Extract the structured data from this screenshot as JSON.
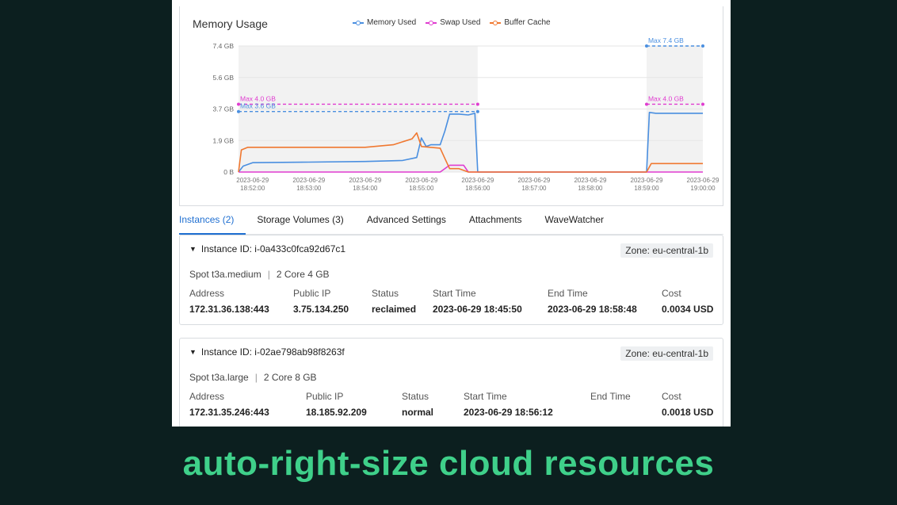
{
  "chart": {
    "title": "Memory Usage",
    "legend": [
      {
        "name": "Memory Used",
        "color": "#4a8fe0"
      },
      {
        "name": "Swap Used",
        "color": "#e03cd0"
      },
      {
        "name": "Buffer Cache",
        "color": "#f07830"
      }
    ],
    "y_ticks": [
      "7.4 GB",
      "5.6 GB",
      "3.7 GB",
      "1.9 GB",
      "0 B"
    ],
    "x_ticks": [
      {
        "date": "2023-06-29",
        "time": "18:52:00"
      },
      {
        "date": "2023-06-29",
        "time": "18:53:00"
      },
      {
        "date": "2023-06-29",
        "time": "18:54:00"
      },
      {
        "date": "2023-06-29",
        "time": "18:55:00"
      },
      {
        "date": "2023-06-29",
        "time": "18:56:00"
      },
      {
        "date": "2023-06-29",
        "time": "18:57:00"
      },
      {
        "date": "2023-06-29",
        "time": "18:58:00"
      },
      {
        "date": "2023-06-29",
        "time": "18:59:00"
      },
      {
        "date": "2023-06-29",
        "time": "19:00:00"
      }
    ],
    "annotations": {
      "first_max_swap": "Max 4.0 GB",
      "first_max_mem": "Max 3.6 GB",
      "second_max_mem": "Max 7.4 GB",
      "second_max_swap": "Max 4.0 GB"
    }
  },
  "chart_data": {
    "type": "line",
    "title": "Memory Usage",
    "x_unit": "time (2023-06-29)",
    "y_unit": "GB",
    "ylim": [
      0,
      7.4
    ],
    "xlim": [
      "18:51:45",
      "19:00:00"
    ],
    "shaded_regions": [
      [
        "18:51:45",
        "18:56:00"
      ],
      [
        "18:59:00",
        "19:00:00"
      ]
    ],
    "series": [
      {
        "name": "Memory Used",
        "color": "#4a8fe0",
        "points": [
          [
            "18:51:45",
            0
          ],
          [
            "18:51:50",
            0.35
          ],
          [
            "18:52:00",
            0.55
          ],
          [
            "18:53:00",
            0.58
          ],
          [
            "18:54:00",
            0.62
          ],
          [
            "18:54:40",
            0.68
          ],
          [
            "18:54:55",
            0.85
          ],
          [
            "18:55:00",
            2.0
          ],
          [
            "18:55:05",
            1.5
          ],
          [
            "18:55:10",
            1.6
          ],
          [
            "18:55:20",
            1.6
          ],
          [
            "18:55:25",
            2.4
          ],
          [
            "18:55:30",
            3.4
          ],
          [
            "18:55:40",
            3.4
          ],
          [
            "18:55:50",
            3.35
          ],
          [
            "18:55:57",
            3.45
          ],
          [
            "18:56:00",
            0
          ],
          [
            "18:59:00",
            0
          ],
          [
            "18:59:03",
            3.5
          ],
          [
            "18:59:10",
            3.45
          ],
          [
            "19:00:00",
            3.45
          ]
        ]
      },
      {
        "name": "Swap Used",
        "color": "#e03cd0",
        "points": [
          [
            "18:51:45",
            0
          ],
          [
            "18:55:20",
            0
          ],
          [
            "18:55:30",
            0.4
          ],
          [
            "18:55:45",
            0.4
          ],
          [
            "18:55:50",
            0
          ],
          [
            "19:00:00",
            0
          ]
        ]
      },
      {
        "name": "Buffer Cache",
        "color": "#f07830",
        "points": [
          [
            "18:51:45",
            0
          ],
          [
            "18:51:48",
            1.3
          ],
          [
            "18:51:55",
            1.45
          ],
          [
            "18:54:00",
            1.45
          ],
          [
            "18:54:30",
            1.6
          ],
          [
            "18:54:50",
            1.95
          ],
          [
            "18:54:55",
            2.3
          ],
          [
            "18:55:00",
            1.5
          ],
          [
            "18:55:20",
            1.4
          ],
          [
            "18:55:25",
            0.8
          ],
          [
            "18:55:30",
            0.2
          ],
          [
            "18:55:40",
            0.2
          ],
          [
            "18:55:50",
            0
          ],
          [
            "18:59:00",
            0
          ],
          [
            "18:59:05",
            0.5
          ],
          [
            "19:00:00",
            0.5
          ]
        ]
      }
    ]
  },
  "tabs": [
    "Instances (2)",
    "Storage Volumes (3)",
    "Advanced Settings",
    "Attachments",
    "WaveWatcher"
  ],
  "headers": {
    "address": "Address",
    "public_ip": "Public IP",
    "status": "Status",
    "start": "Start Time",
    "end": "End Time",
    "cost": "Cost"
  },
  "instances": [
    {
      "id": "Instance ID: i-0a433c0fca92d67c1",
      "zone": "Zone: eu-central-1b",
      "type": "Spot t3a.medium",
      "spec": "2 Core 4 GB",
      "address": "172.31.36.138:443",
      "public_ip": "3.75.134.250",
      "status": "reclaimed",
      "start": "2023-06-29 18:45:50",
      "end": "2023-06-29 18:58:48",
      "cost": "0.0034 USD"
    },
    {
      "id": "Instance ID: i-02ae798ab98f8263f",
      "zone": "Zone: eu-central-1b",
      "type": "Spot t3a.large",
      "spec": "2 Core 8 GB",
      "address": "172.31.35.246:443",
      "public_ip": "18.185.92.209",
      "status": "normal",
      "start": "2023-06-29 18:56:12",
      "end": "",
      "cost": "0.0018 USD"
    }
  ],
  "caption": "auto-right-size cloud resources"
}
